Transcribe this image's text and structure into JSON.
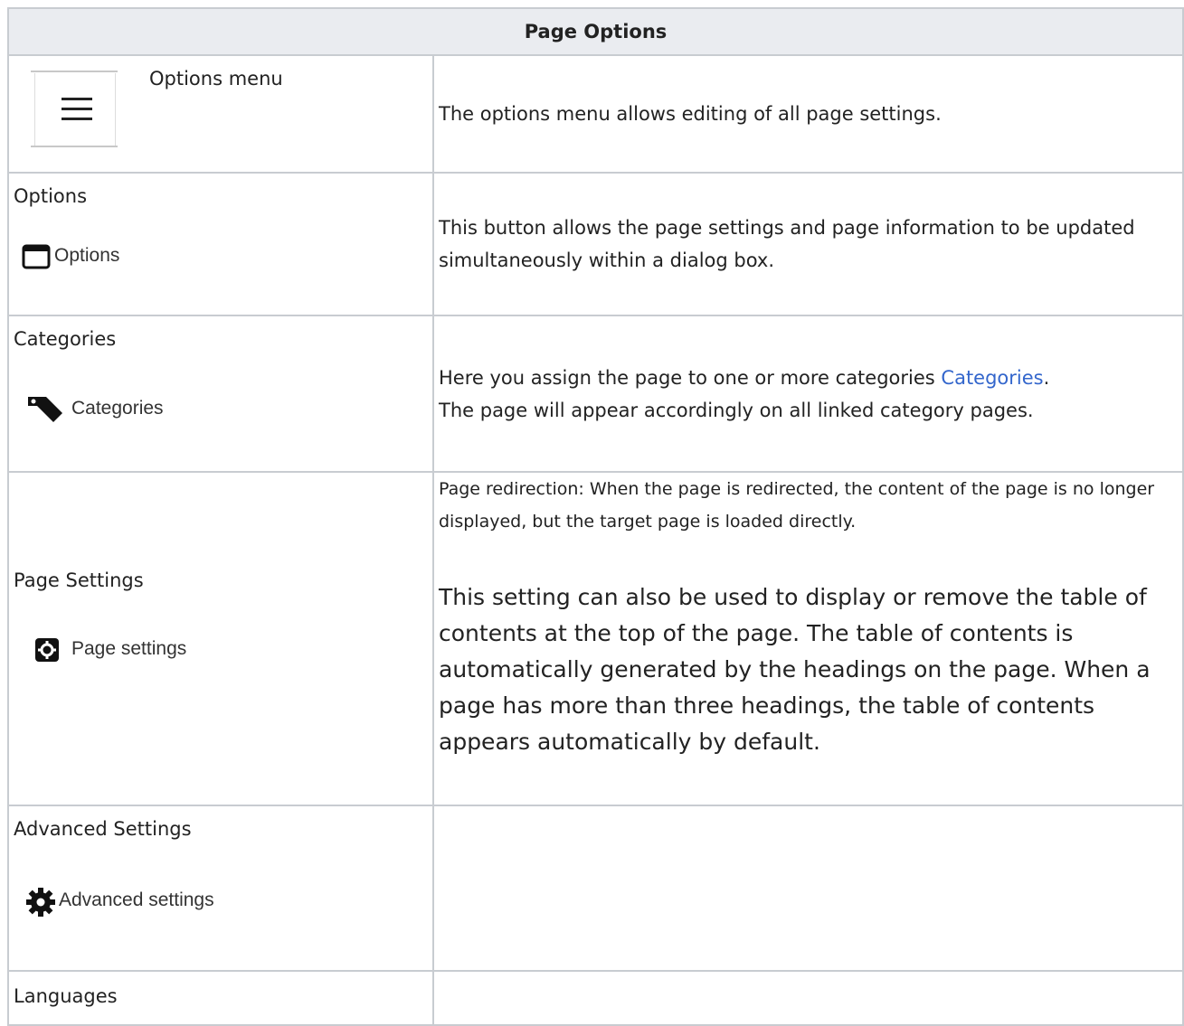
{
  "table": {
    "header": "Page Options",
    "rows": [
      {
        "label": "Options menu",
        "description": "The options menu allows editing of all page settings."
      },
      {
        "label": "Options",
        "button_label": "Options",
        "description": "This button allows the page settings and page information to be updated simultaneously within a dialog box."
      },
      {
        "label": "Categories",
        "button_label": "Categories",
        "description_before": "Here you assign the page to one or more categories ",
        "link_text": "Categories",
        "description_after": ".",
        "description_line2": "The page will appear accordingly on all linked category pages."
      },
      {
        "label": "Page Settings",
        "button_label": "Page settings",
        "description_small": "Page redirection: When the page is redirected, the content of the page is no longer displayed, but the target page is loaded directly.",
        "description_large": "This setting can also be used to display or remove the table of contents at the top of the page. The table of contents is automatically generated by the headings on the page. When a page has more than three headings, the table of contents appears automatically by default."
      },
      {
        "label": "Advanced Settings",
        "button_label": "Advanced settings",
        "description": ""
      },
      {
        "label": "Languages",
        "description": ""
      }
    ]
  },
  "icons": [
    "hamburger-menu-icon",
    "window-icon",
    "tag-icon",
    "gear-square-icon",
    "cog-icon"
  ]
}
